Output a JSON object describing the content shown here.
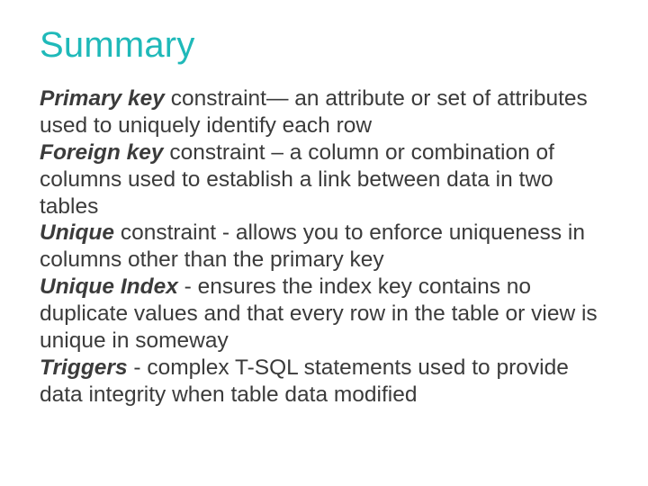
{
  "title": "Summary",
  "items": [
    {
      "term": "Primary key",
      "desc": " constraint— an attribute or set of attributes used to uniquely identify each row"
    },
    {
      "term": "Foreign key",
      "desc": " constraint – a column or combination of columns used to establish a link between data in two tables"
    },
    {
      "term": "Unique",
      "desc": " constraint - allows you to enforce uniqueness in columns other than the primary key"
    },
    {
      "term": "Unique Index",
      "desc": " - ensures the index key contains no duplicate values and that every row in the table or view is unique in someway"
    },
    {
      "term": "Triggers",
      "desc": " - complex T-SQL statements used to provide data integrity when table data modified"
    }
  ]
}
